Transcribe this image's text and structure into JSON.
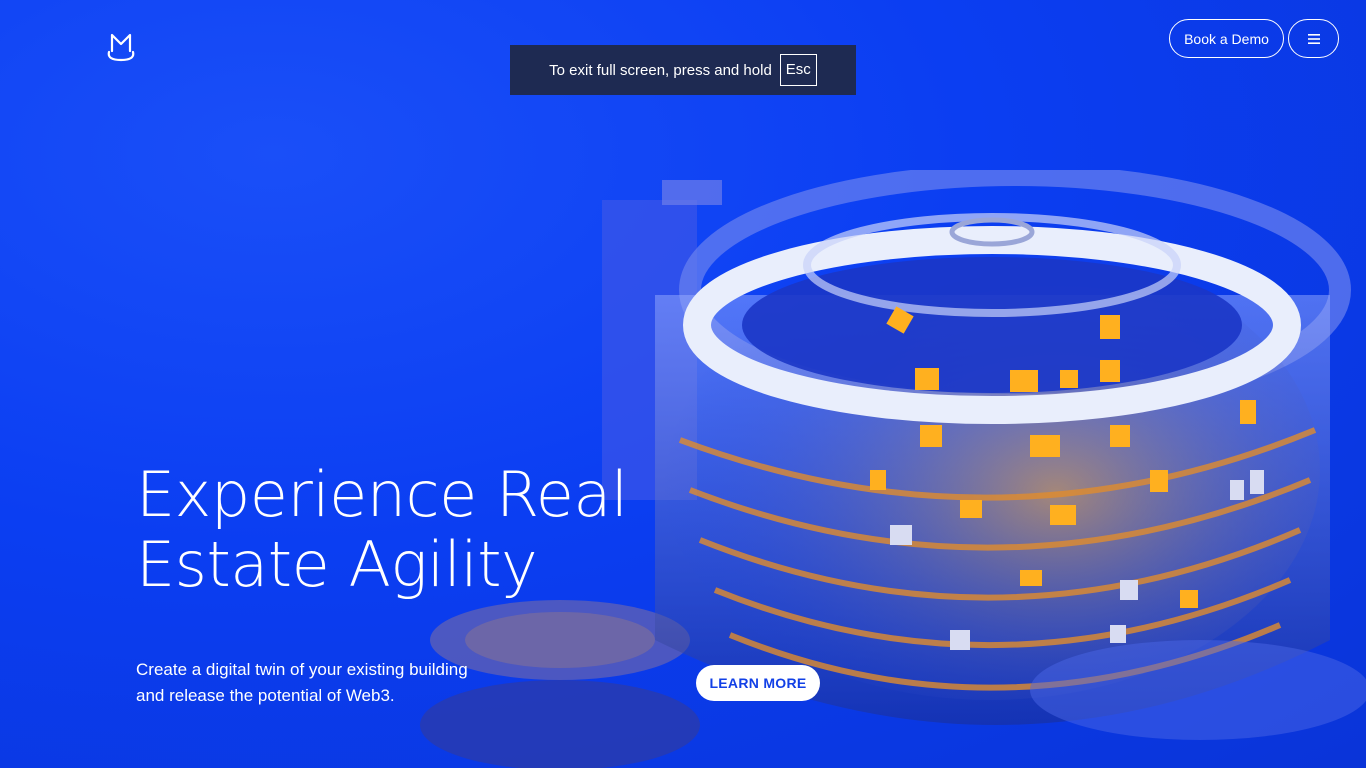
{
  "header": {
    "logo_icon": "m-crown-logo-icon",
    "book_demo_label": "Book a Demo",
    "menu_icon": "hamburger-menu-icon"
  },
  "fullscreen_notice": {
    "text": "To exit full screen, press and hold",
    "key": "Esc"
  },
  "hero": {
    "title_line1": "Experience Real",
    "title_line2": "Estate Agility",
    "subtitle_line1": "Create a digital twin of your existing building",
    "subtitle_line2": "and release the potential of Web3.",
    "cta_label": "LEARN MORE"
  },
  "colors": {
    "background": "#0b3ef2",
    "accent": "#ffffff",
    "cta_text": "#1240e6",
    "toast_bg": "#1e2a52",
    "window_light": "#ffb020"
  }
}
